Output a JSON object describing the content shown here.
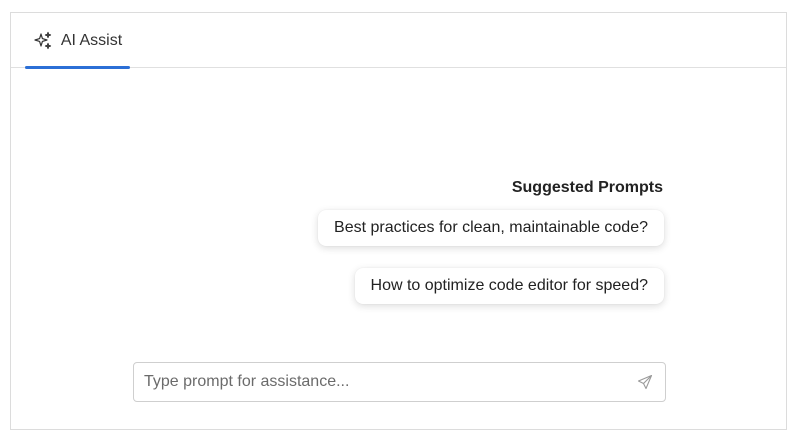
{
  "tabs": [
    {
      "label": "AI Assist",
      "icon": "sparkle-icon",
      "active": true
    }
  ],
  "suggestions": {
    "title": "Suggested Prompts",
    "items": [
      "Best practices for clean, maintainable code?",
      "How to optimize code editor for speed?"
    ]
  },
  "prompt_input": {
    "value": "",
    "placeholder": "Type prompt for assistance...",
    "send_icon": "send-icon"
  },
  "colors": {
    "accent": "#2b6fd6",
    "border": "#dcdcdc",
    "text": "#222222"
  }
}
